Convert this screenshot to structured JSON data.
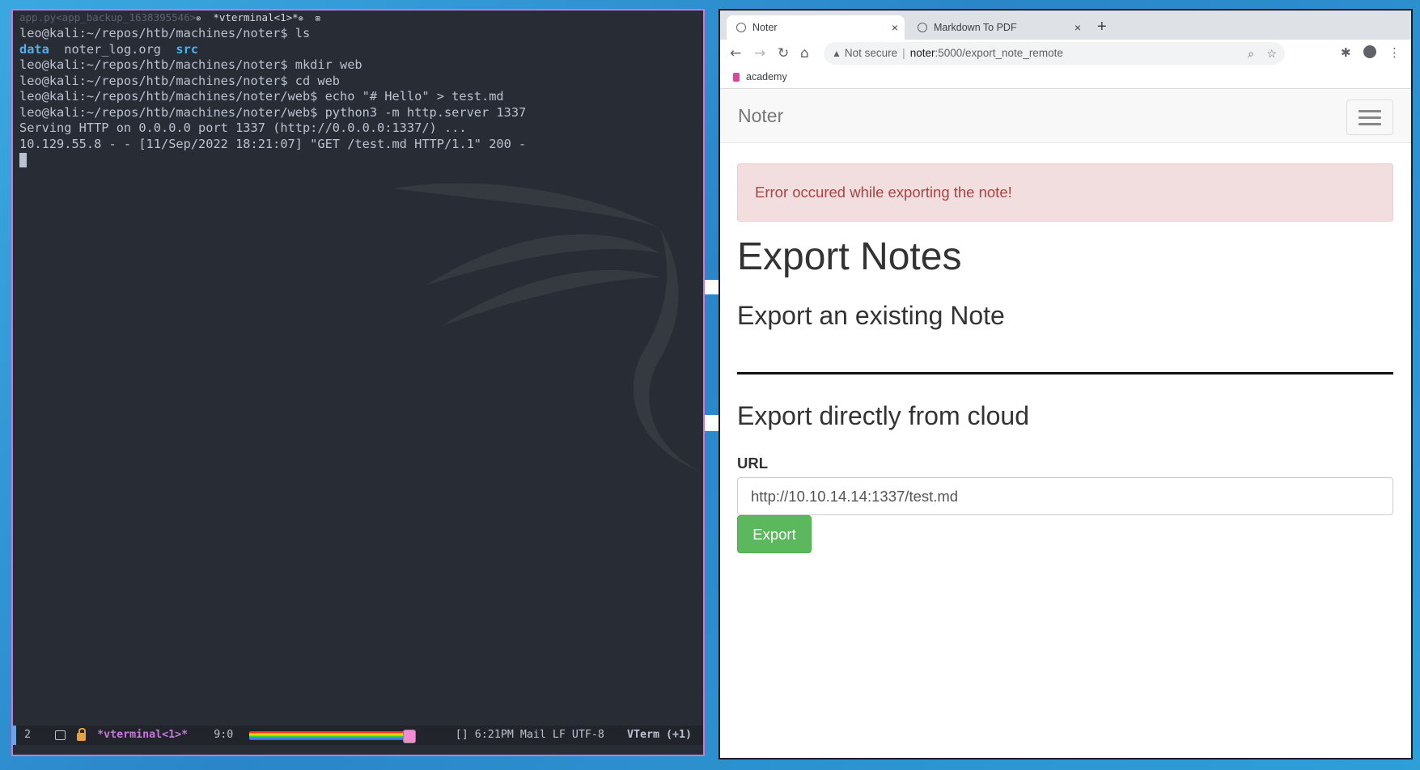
{
  "colors": {
    "emacs_border": "#c678dd",
    "terminal_bg": "#282c34",
    "dir": "#51afef",
    "alert_text": "#a94442",
    "alert_bg": "#f2dede",
    "export_button": "#5cb85c"
  },
  "emacs": {
    "tabline": {
      "tab1": "app.py<app_backup_1638395546>",
      "tab2": "*vterminal<1>*",
      "close_glyph": "⊗",
      "add_glyph": "⊞"
    },
    "terminal": {
      "lines": [
        {
          "prompt": "leo@kali:~/repos/htb/machines/noter$",
          "cmd": " ls"
        },
        {
          "ls": [
            "data",
            "noter_log.org",
            "src"
          ]
        },
        {
          "prompt": "leo@kali:~/repos/htb/machines/noter$",
          "cmd": " mkdir web"
        },
        {
          "prompt": "leo@kali:~/repos/htb/machines/noter$",
          "cmd": " cd web"
        },
        {
          "prompt": "leo@kali:~/repos/htb/machines/noter/web$",
          "cmd": " echo \"# Hello\" > test.md"
        },
        {
          "prompt": "leo@kali:~/repos/htb/machines/noter/web$",
          "cmd": " python3 -m http.server 1337"
        },
        {
          "out": "Serving HTTP on 0.0.0.0 port 1337 (http://0.0.0.0:1337/) ..."
        },
        {
          "out": "10.129.55.8 - - [11/Sep/2022 18:21:07] \"GET /test.md HTTP/1.1\" 200 -"
        }
      ]
    },
    "modeline": {
      "window_number": "2",
      "buffer": "*vterminal<1>*",
      "position": "9:0",
      "right_info": "[] 6:21PM Mail  LF UTF-8",
      "mode": "VTerm (+1)"
    }
  },
  "browser": {
    "tabs": [
      {
        "label": "Noter",
        "close": "×"
      },
      {
        "label": "Markdown To PDF",
        "close": "×"
      }
    ],
    "new_tab": "+",
    "nav": {
      "back": "←",
      "forward": "→",
      "reload": "↻",
      "home": "⌂"
    },
    "address": {
      "warning_icon": "▲",
      "security_label": "Not secure",
      "host": "noter",
      "path": ":5000/export_note_remote"
    },
    "bookmarks": [
      {
        "label": "academy"
      }
    ],
    "page": {
      "brand": "Noter",
      "alert": "Error occured while exporting the note!",
      "heading": "Export Notes",
      "subheading_existing": "Export an existing Note",
      "subheading_cloud": "Export directly from cloud",
      "url_label": "URL",
      "url_value": "http://10.10.14.14:1337/test.md",
      "export_button": "Export"
    }
  }
}
